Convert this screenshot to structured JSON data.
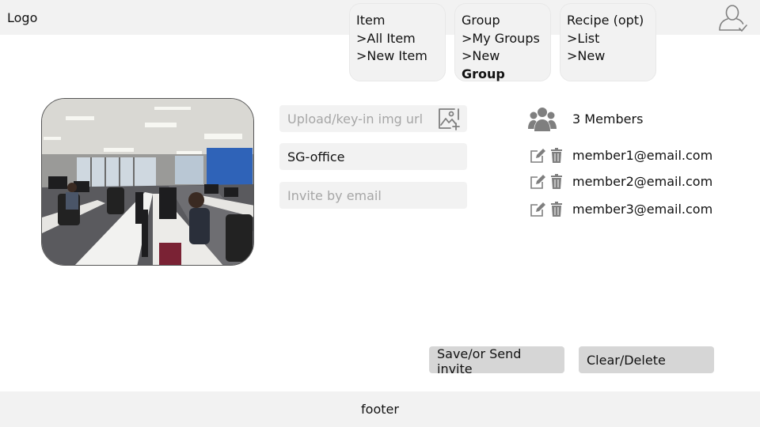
{
  "header": {
    "logo": "Logo"
  },
  "menus": {
    "item": {
      "title": "Item",
      "links": [
        ">All Item",
        ">New Item"
      ]
    },
    "group": {
      "title": "Group",
      "links": [
        ">My Groups",
        ">New"
      ],
      "active": "Group"
    },
    "recipe": {
      "title": "Recipe (opt)",
      "links": [
        ">List",
        ">New"
      ]
    }
  },
  "form": {
    "img_url_placeholder": "Upload/key-in img url",
    "group_name_value": "SG-office",
    "invite_placeholder": "Invite by email"
  },
  "members": {
    "count_label": "3 Members",
    "list": [
      "member1@email.com",
      "member2@email.com",
      "member3@email.com"
    ]
  },
  "buttons": {
    "save": "Save/or Send invite",
    "clear": "Clear/Delete"
  },
  "footer": {
    "text": "footer"
  },
  "icons": {
    "user": "user-check-icon",
    "image_add": "image-add-icon",
    "members": "group-icon",
    "edit": "edit-icon",
    "delete": "trash-icon"
  },
  "colors": {
    "panel": "#f2f2f2",
    "button": "#d6d6d6",
    "placeholder": "#a6a6a6",
    "icon": "#7f7f7f"
  }
}
